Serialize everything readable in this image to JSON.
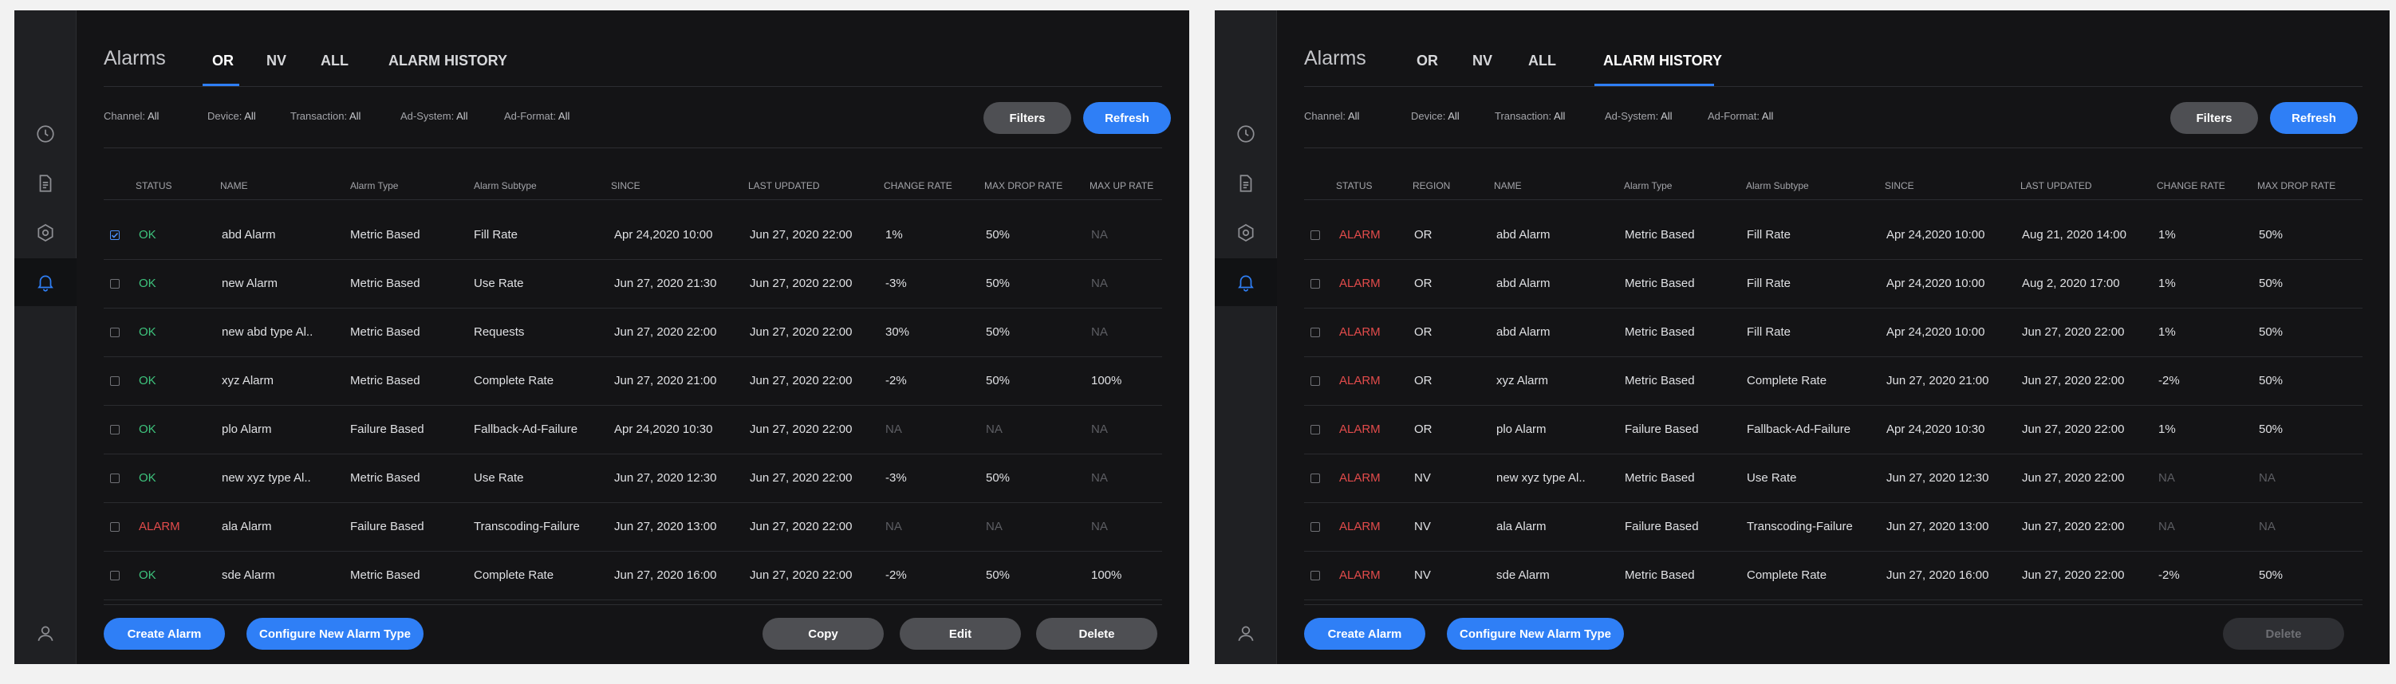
{
  "colors": {
    "accent": "#2f7ff6",
    "ok": "#3ec47d",
    "alarm": "#e24b4b",
    "panel_bg": "#141416",
    "sidebar_bg": "#1f2023"
  },
  "sidebar_icons": [
    "clock-icon",
    "document-icon",
    "settings-icon",
    "bell-icon",
    "user-icon"
  ],
  "screenA": {
    "title": "Alarms",
    "tabs": [
      "OR",
      "NV",
      "ALL",
      "ALARM HISTORY"
    ],
    "active_tab": "OR",
    "filters": [
      {
        "label": "Channel: ",
        "value": "All"
      },
      {
        "label": "Device: ",
        "value": "All"
      },
      {
        "label": "Transaction: ",
        "value": "All"
      },
      {
        "label": "Ad-System: ",
        "value": "All"
      },
      {
        "label": "Ad-Format: ",
        "value": "All"
      }
    ],
    "buttons": {
      "filters": "Filters",
      "refresh": "Refresh",
      "create": "Create Alarm",
      "configure": "Configure New Alarm Type",
      "copy": "Copy",
      "edit": "Edit",
      "delete": "Delete"
    },
    "columns": [
      "STATUS",
      "NAME",
      "Alarm Type",
      "Alarm Subtype",
      "SINCE",
      "LAST UPDATED",
      "CHANGE RATE",
      "MAX DROP RATE",
      "MAX UP RATE"
    ],
    "rows": [
      {
        "checked": true,
        "status": "OK",
        "name": "abd Alarm",
        "type": "Metric Based",
        "subtype": "Fill Rate",
        "since": "Apr 24,2020 10:00",
        "updated": "Jun 27, 2020 22:00",
        "change": "1%",
        "drop": "50%",
        "up": "NA"
      },
      {
        "checked": false,
        "status": "OK",
        "name": "new Alarm",
        "type": "Metric Based",
        "subtype": "Use Rate",
        "since": "Jun 27, 2020 21:30",
        "updated": "Jun 27, 2020 22:00",
        "change": "-3%",
        "drop": "50%",
        "up": "NA"
      },
      {
        "checked": false,
        "status": "OK",
        "name": "new abd type Al..",
        "type": "Metric Based",
        "subtype": "Requests",
        "since": "Jun 27, 2020 22:00",
        "updated": "Jun 27, 2020 22:00",
        "change": "30%",
        "drop": "50%",
        "up": "NA"
      },
      {
        "checked": false,
        "status": "OK",
        "name": "xyz Alarm",
        "type": "Metric Based",
        "subtype": "Complete Rate",
        "since": "Jun 27, 2020 21:00",
        "updated": "Jun 27, 2020 22:00",
        "change": "-2%",
        "drop": "50%",
        "up": "100%"
      },
      {
        "checked": false,
        "status": "OK",
        "name": "plo Alarm",
        "type": "Failure Based",
        "subtype": "Fallback-Ad-Failure",
        "since": "Apr 24,2020 10:30",
        "updated": "Jun 27, 2020 22:00",
        "change": "NA",
        "drop": "NA",
        "up": "NA"
      },
      {
        "checked": false,
        "status": "OK",
        "name": "new xyz type Al..",
        "type": "Metric Based",
        "subtype": "Use Rate",
        "since": "Jun 27, 2020 12:30",
        "updated": "Jun 27, 2020 22:00",
        "change": "-3%",
        "drop": "50%",
        "up": "NA"
      },
      {
        "checked": false,
        "status": "ALARM",
        "name": "ala Alarm",
        "type": "Failure Based",
        "subtype": "Transcoding-Failure",
        "since": "Jun 27, 2020 13:00",
        "updated": "Jun 27, 2020 22:00",
        "change": "NA",
        "drop": "NA",
        "up": "NA"
      },
      {
        "checked": false,
        "status": "OK",
        "name": "sde Alarm",
        "type": "Metric Based",
        "subtype": "Complete Rate",
        "since": "Jun 27, 2020 16:00",
        "updated": "Jun 27, 2020 22:00",
        "change": "-2%",
        "drop": "50%",
        "up": "100%"
      }
    ]
  },
  "screenB": {
    "title": "Alarms",
    "tabs": [
      "OR",
      "NV",
      "ALL",
      "ALARM HISTORY"
    ],
    "active_tab": "ALARM HISTORY",
    "filters": [
      {
        "label": "Channel: ",
        "value": "All"
      },
      {
        "label": "Device: ",
        "value": "All"
      },
      {
        "label": "Transaction: ",
        "value": "All"
      },
      {
        "label": "Ad-System: ",
        "value": "All"
      },
      {
        "label": "Ad-Format: ",
        "value": "All"
      }
    ],
    "buttons": {
      "filters": "Filters",
      "refresh": "Refresh",
      "create": "Create Alarm",
      "configure": "Configure New Alarm Type",
      "delete": "Delete"
    },
    "columns": [
      "STATUS",
      "REGION",
      "NAME",
      "Alarm Type",
      "Alarm Subtype",
      "SINCE",
      "LAST UPDATED",
      "CHANGE RATE",
      "MAX DROP RATE"
    ],
    "rows": [
      {
        "checked": false,
        "status": "ALARM",
        "region": "OR",
        "name": "abd Alarm",
        "type": "Metric Based",
        "subtype": "Fill Rate",
        "since": "Apr 24,2020 10:00",
        "updated": "Aug 21, 2020 14:00",
        "change": "1%",
        "drop": "50%"
      },
      {
        "checked": false,
        "status": "ALARM",
        "region": "OR",
        "name": "abd Alarm",
        "type": "Metric Based",
        "subtype": "Fill Rate",
        "since": "Apr 24,2020 10:00",
        "updated": "Aug 2, 2020 17:00",
        "change": "1%",
        "drop": "50%"
      },
      {
        "checked": false,
        "status": "ALARM",
        "region": "OR",
        "name": "abd Alarm",
        "type": "Metric Based",
        "subtype": "Fill Rate",
        "since": "Apr 24,2020 10:00",
        "updated": "Jun 27, 2020 22:00",
        "change": "1%",
        "drop": "50%"
      },
      {
        "checked": false,
        "status": "ALARM",
        "region": "OR",
        "name": "xyz Alarm",
        "type": "Metric Based",
        "subtype": "Complete Rate",
        "since": "Jun 27, 2020 21:00",
        "updated": "Jun 27, 2020 22:00",
        "change": "-2%",
        "drop": "50%"
      },
      {
        "checked": false,
        "status": "ALARM",
        "region": "OR",
        "name": "plo Alarm",
        "type": "Failure Based",
        "subtype": "Fallback-Ad-Failure",
        "since": "Apr 24,2020 10:30",
        "updated": "Jun 27, 2020 22:00",
        "change": "1%",
        "drop": "50%"
      },
      {
        "checked": false,
        "status": "ALARM",
        "region": "NV",
        "name": "new xyz type Al..",
        "type": "Metric Based",
        "subtype": "Use Rate",
        "since": "Jun 27, 2020 12:30",
        "updated": "Jun 27, 2020 22:00",
        "change": "NA",
        "drop": "NA"
      },
      {
        "checked": false,
        "status": "ALARM",
        "region": "NV",
        "name": "ala Alarm",
        "type": "Failure Based",
        "subtype": "Transcoding-Failure",
        "since": "Jun 27, 2020 13:00",
        "updated": "Jun 27, 2020 22:00",
        "change": "NA",
        "drop": "NA"
      },
      {
        "checked": false,
        "status": "ALARM",
        "region": "NV",
        "name": "sde Alarm",
        "type": "Metric Based",
        "subtype": "Complete Rate",
        "since": "Jun 27, 2020 16:00",
        "updated": "Jun 27, 2020 22:00",
        "change": "-2%",
        "drop": "50%"
      }
    ]
  }
}
